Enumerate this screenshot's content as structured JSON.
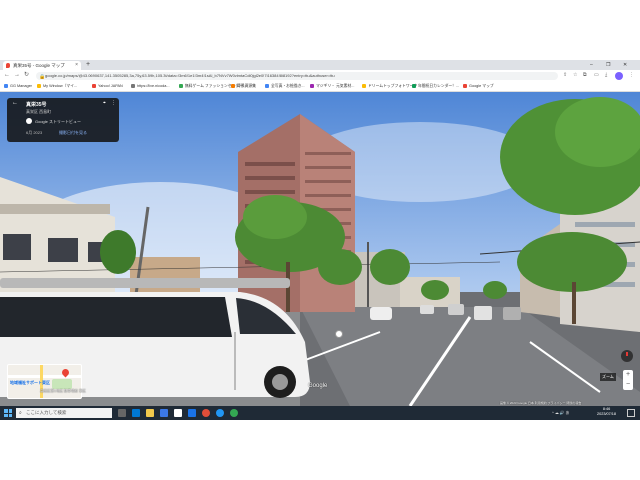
{
  "browser": {
    "tab_title": "真栄35号 - Google マップ",
    "new_tab": "+",
    "window_controls": {
      "minimize": "–",
      "restore": "❐",
      "close": "✕"
    },
    "url": "google.co.jp/maps/@43.0690637,141.3505285,3a,75y,63.59h,105.3t/data=!3m6!1e1!3m4!1sAl_b7NVv7W0vlmtaCdl0jgl2e0!7i16384!8i8192?entry=ttu&authuser=ttu",
    "bookmarks": [
      {
        "label": "GG Manager",
        "color": "#4285f4"
      },
      {
        "label": "My Window（マイ...",
        "color": "#fbbc05"
      },
      {
        "label": "Yahoo! JAPAN",
        "color": "#ea4335"
      },
      {
        "label": "https://live.nicoda...",
        "color": "#777777"
      },
      {
        "label": "無料ゲーム ファッションセンター...",
        "color": "#34a853"
      },
      {
        "label": "背景資源集",
        "color": "#f57c00"
      },
      {
        "label": "全写真・お絵描き...",
        "color": "#4285f4"
      },
      {
        "label": "マジギリ・ 元気素材...",
        "color": "#9c27b0"
      },
      {
        "label": "ドリームトップフォトワーク",
        "color": "#fbbc05"
      },
      {
        "label": "年間祝日カレンダー！...",
        "color": "#0f9d58"
      },
      {
        "label": "Google マップ",
        "color": "#ea4335"
      }
    ]
  },
  "street_view": {
    "place_name": "真栄35号",
    "locality": "真栄区 西島町",
    "brand": "Google ストリートビュー",
    "capture_date": "6月 2023",
    "more_dates": "撮影日付を見る",
    "minimap_label": "地域福祉サポート東区",
    "minimap_caption": "高田区第1地区 駐車場前 東区",
    "google_logo": "Google",
    "copyright": "画像 © 2023 Google 日本 利用規約 プライバシー 問題の報告",
    "zoom_label": "ズーム",
    "zoom_in": "+",
    "zoom_out": "−"
  },
  "taskbar": {
    "search_placeholder": "ここに入力して検索",
    "tray_text": "^ ☁ 🔊 あ",
    "time": "8:46",
    "date": "2023/07/18"
  },
  "colors": {
    "sky": "#6a97d8",
    "taskbar": "#1f2a36",
    "accent": "#1a73e8"
  }
}
